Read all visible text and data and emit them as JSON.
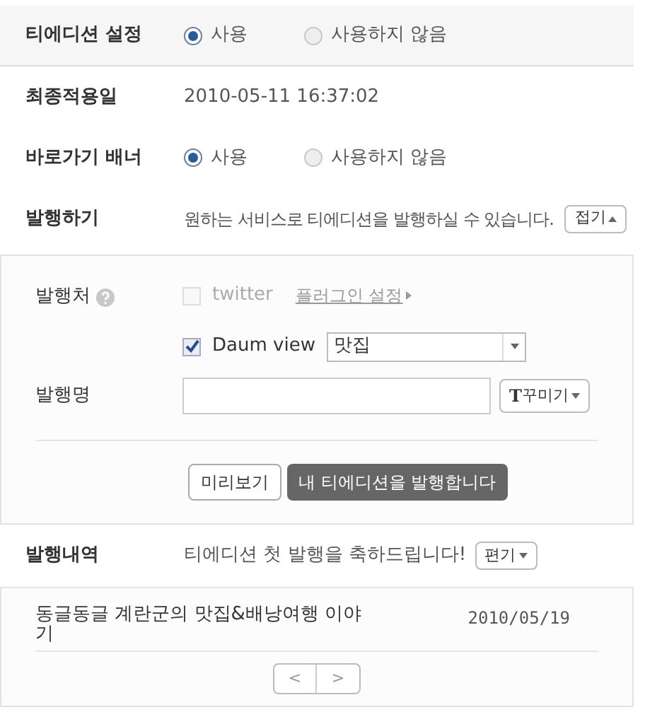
{
  "settings": [
    {
      "kind": "radio",
      "label": "티에디션 설정",
      "options": [
        {
          "label": "사용",
          "selected": true
        },
        {
          "label": "사용하지 않음",
          "selected": false
        }
      ]
    },
    {
      "kind": "text",
      "label": "최종적용일",
      "value": "2010-05-11 16:37:02"
    },
    {
      "kind": "radio",
      "label": "바로가기 배너",
      "options": [
        {
          "label": "사용",
          "selected": true
        },
        {
          "label": "사용하지 않음",
          "selected": false
        }
      ]
    },
    {
      "kind": "publish",
      "label": "발행하기",
      "value": "원하는 서비스로 티에디션을 발행하실 수 있습니다.",
      "toggle": "접기",
      "expanded": true
    }
  ],
  "publish_panel": {
    "target_label": "발행처",
    "targets": [
      {
        "kind": "plugin",
        "label": "twitter",
        "checked": false,
        "disabled": true,
        "link": "플러그인 설정"
      },
      {
        "kind": "category",
        "label": "Daum view",
        "checked": true,
        "disabled": false,
        "category": "맛집"
      }
    ],
    "name_label": "발행명",
    "decorate_button": "꾸미기",
    "decorate_glyph": "T",
    "preview_button": "미리보기",
    "publish_button": "내 티에디션을 발행합니다"
  },
  "history": {
    "label": "발행내역",
    "message": "티에디션 첫 발행을 축하드립니다!",
    "edit_button": "편기",
    "rows": [
      {
        "title": "동글동글 계란군의 맛집&배낭여행 이야기",
        "date": "2010/05/19"
      }
    ],
    "pager": [
      "<",
      ">"
    ]
  }
}
